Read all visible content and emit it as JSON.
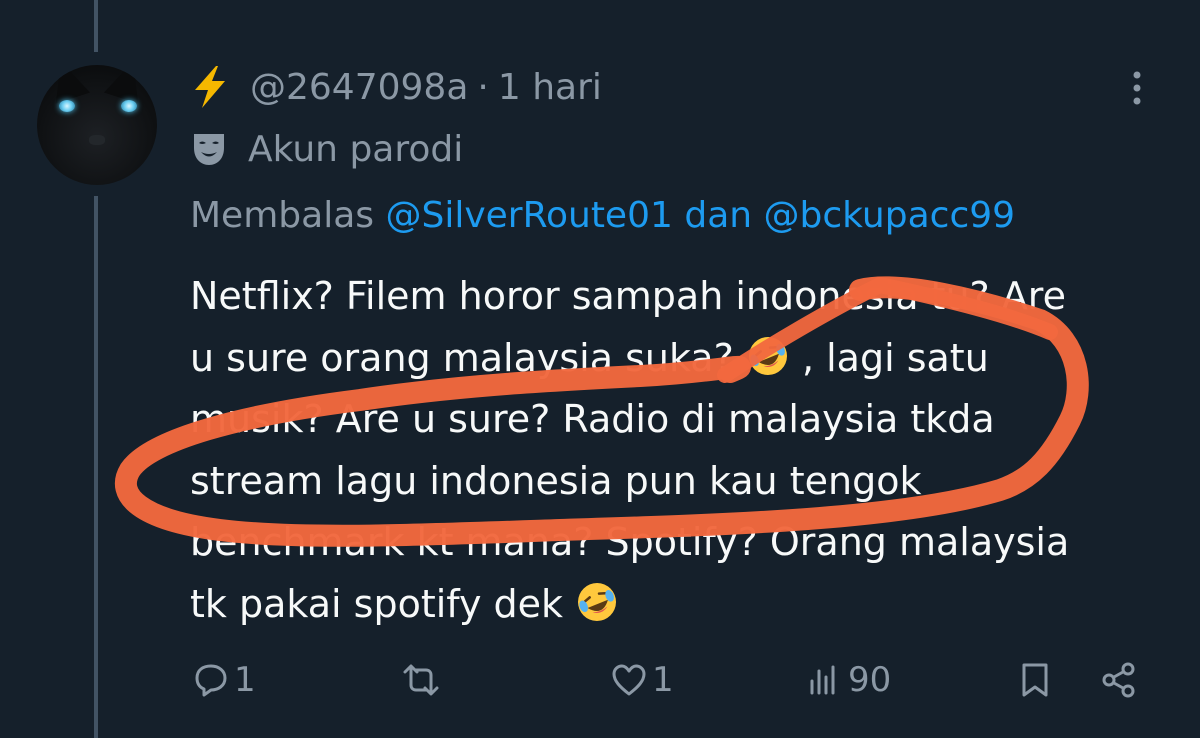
{
  "author": {
    "handle": "@2647098a",
    "separator": "·",
    "time": "1 hari",
    "label": "Akun parodi"
  },
  "reply": {
    "prefix": "Membalas",
    "mention1": "@SilverRoute01",
    "conjunction": "dan",
    "mention2": "@bckupacc99"
  },
  "tweet": {
    "line1": "Netflix? Filem horor sampah indonesia tu? Are",
    "line2a": "u sure orang malaysia suka?",
    "line2b": ", lagi satu",
    "line3": "musik? Are u sure? Radio di malaysia tkda",
    "line4": "stream lagu indonesia pun kau tengok",
    "line5": "benchmark kt mana? Spotify? Orang malaysia",
    "line6": "tk pakai spotify dek"
  },
  "stats": {
    "replies": "1",
    "likes": "1",
    "views": "90"
  },
  "colors": {
    "background": "#15202b",
    "text": "#f7f9f9",
    "muted": "#8b98a5",
    "link": "#1d9bf0",
    "scribble": "#f2683e"
  },
  "icons": [
    "lightning-icon",
    "parody-mask-icon",
    "more-icon",
    "reply-icon",
    "repost-icon",
    "like-icon",
    "views-icon",
    "bookmark-icon",
    "share-icon",
    "rofl-emoji"
  ]
}
